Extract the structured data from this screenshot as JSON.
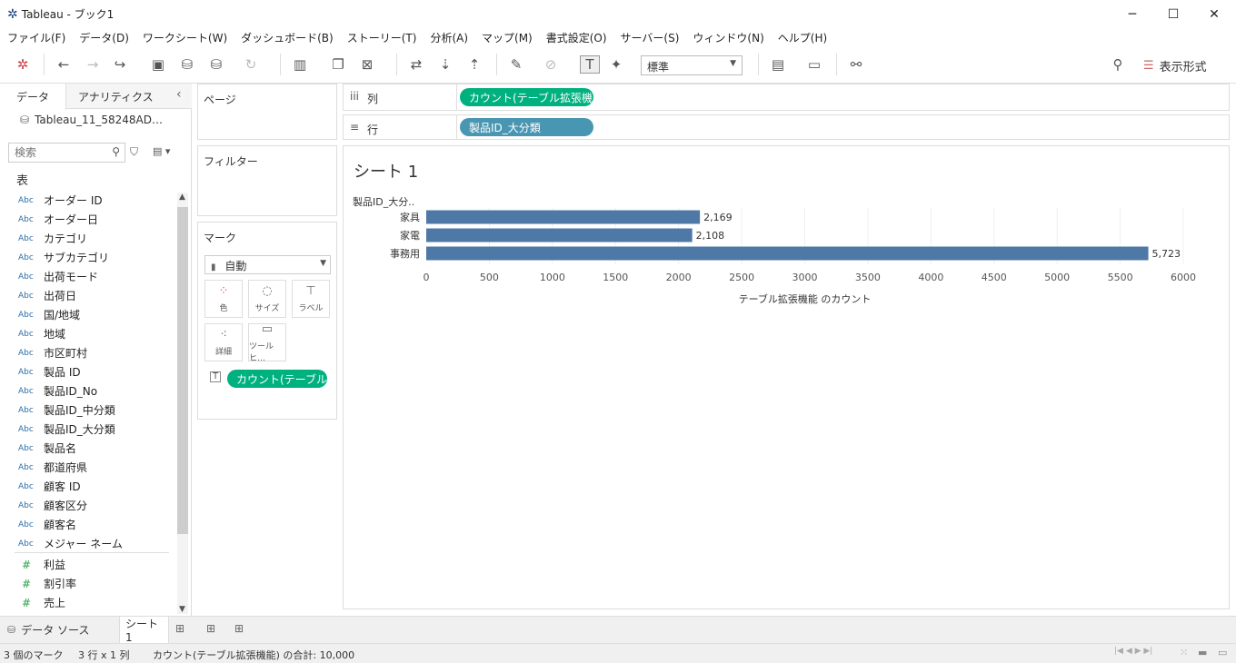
{
  "window": {
    "title": "Tableau - ブック1",
    "minimize": "─",
    "maximize": "☐",
    "close": "✕"
  },
  "menu": [
    "ファイル(F)",
    "データ(D)",
    "ワークシート(W)",
    "ダッシュボード(B)",
    "ストーリー(T)",
    "分析(A)",
    "マップ(M)",
    "書式設定(O)",
    "サーバー(S)",
    "ウィンドウ(N)",
    "ヘルプ(H)"
  ],
  "toolbar": {
    "fit_select": "標準",
    "show_me": "表示形式"
  },
  "leftpane": {
    "tab_data": "データ",
    "tab_analytics": "アナリティクス",
    "collapse": "‹",
    "datasource": "Tableau_11_58248AD…",
    "search_placeholder": "検索",
    "section_table": "表",
    "dimension_type": "Abc",
    "measure_type": "#",
    "dimensions": [
      "オーダー ID",
      "オーダー日",
      "カテゴリ",
      "サブカテゴリ",
      "出荷モード",
      "出荷日",
      "国/地域",
      "地域",
      "市区町村",
      "製品 ID",
      "製品ID_No",
      "製品ID_中分類",
      "製品ID_大分類",
      "製品名",
      "都道府県",
      "顧客 ID",
      "顧客区分",
      "顧客名",
      "メジャー ネーム"
    ],
    "measures": [
      "利益",
      "割引率",
      "売上"
    ]
  },
  "shelves": {
    "pages": "ページ",
    "filters": "フィルター",
    "marks": "マーク",
    "marks_type": "自動",
    "mark_buttons": {
      "color": "色",
      "size": "サイズ",
      "label": "ラベル",
      "detail": "詳細",
      "tooltip": "ツールヒ…"
    },
    "marks_pill": "カウント(テーブル..",
    "columns_label": "列",
    "columns_pill": "カウント(テーブル拡張機..",
    "rows_label": "行",
    "rows_pill": "製品ID_大分類"
  },
  "sheet": {
    "title": "シート 1",
    "row_header": "製品ID_大分.."
  },
  "chart_data": {
    "type": "bar",
    "orientation": "horizontal",
    "categories": [
      "家具",
      "家電",
      "事務用"
    ],
    "values": [
      2169,
      2108,
      5723
    ],
    "value_labels": [
      "2,169",
      "2,108",
      "5,723"
    ],
    "xlabel": "テーブル拡張機能 のカウント",
    "xlim": [
      0,
      6000
    ],
    "xticks": [
      0,
      500,
      1000,
      1500,
      2000,
      2500,
      3000,
      3500,
      4000,
      4500,
      5000,
      5500,
      6000
    ],
    "bar_color": "#4e79a7",
    "grid": true
  },
  "tabs": {
    "datasource": "データ ソース",
    "sheet": "シート 1"
  },
  "status": {
    "marks": "3 個のマーク",
    "rows_cols": "3 行 x 1 列",
    "sum": "カウント(テーブル拡張機能) の合計: 10,000"
  }
}
